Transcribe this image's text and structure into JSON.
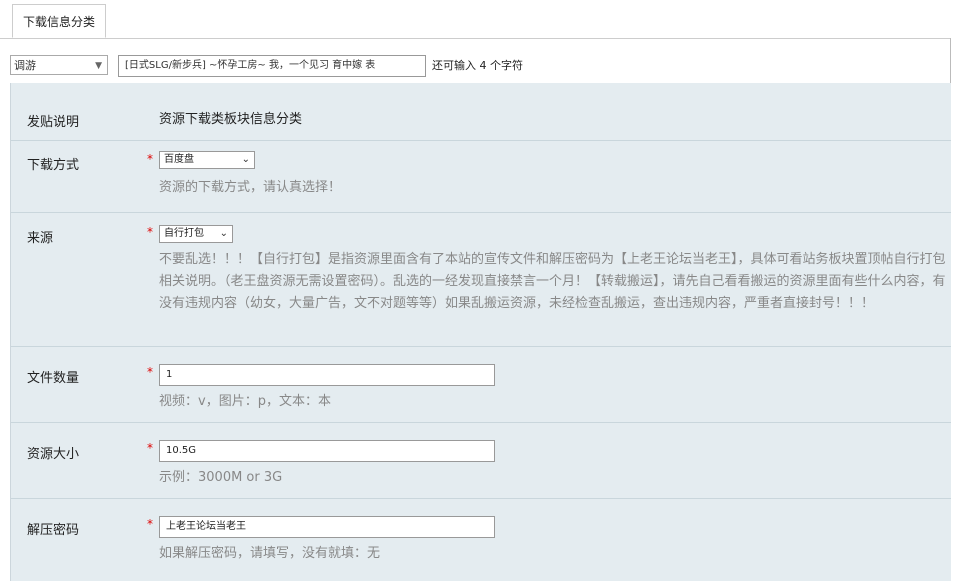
{
  "tab": {
    "label": "下载信息分类"
  },
  "type_select": {
    "value": "调游"
  },
  "title_input": {
    "value": "[日式SLG/新步兵] ~怀孕工房~ 我，一个见习 育中嫁 表"
  },
  "char_hint": "还可输入 4 个字符",
  "rows": {
    "intro": {
      "label": "发贴说明",
      "value": "资源下载类板块信息分类"
    },
    "download": {
      "label": "下载方式",
      "select": "百度盘",
      "desc": "资源的下载方式，请认真选择！"
    },
    "source": {
      "label": "来源",
      "select": "自行打包",
      "desc": "不要乱选！！！【自行打包】是指资源里面含有了本站的宣传文件和解压密码为【上老王论坛当老王】，具体可看站务板块置顶帖自行打包相关说明。（老王盘资源无需设置密码）。乱选的一经发现直接禁言一个月！【转载搬运】，请先自己看看搬运的资源里面有些什么内容，有没有违规内容（幼女，大量广告，文不对题等等）如果乱搬运资源，未经检查乱搬运，查出违规内容，严重者直接封号！！！"
    },
    "file_count": {
      "label": "文件数量",
      "value": "1",
      "desc": "视频：v，图片：p，文本：本"
    },
    "size": {
      "label": "资源大小",
      "value": "10.5G",
      "desc": "示例：3000M or 3G"
    },
    "password": {
      "label": "解压密码",
      "value": "上老王论坛当老王",
      "desc": "如果解压密码，请填写，没有就填：无"
    }
  },
  "required_mark": "*"
}
